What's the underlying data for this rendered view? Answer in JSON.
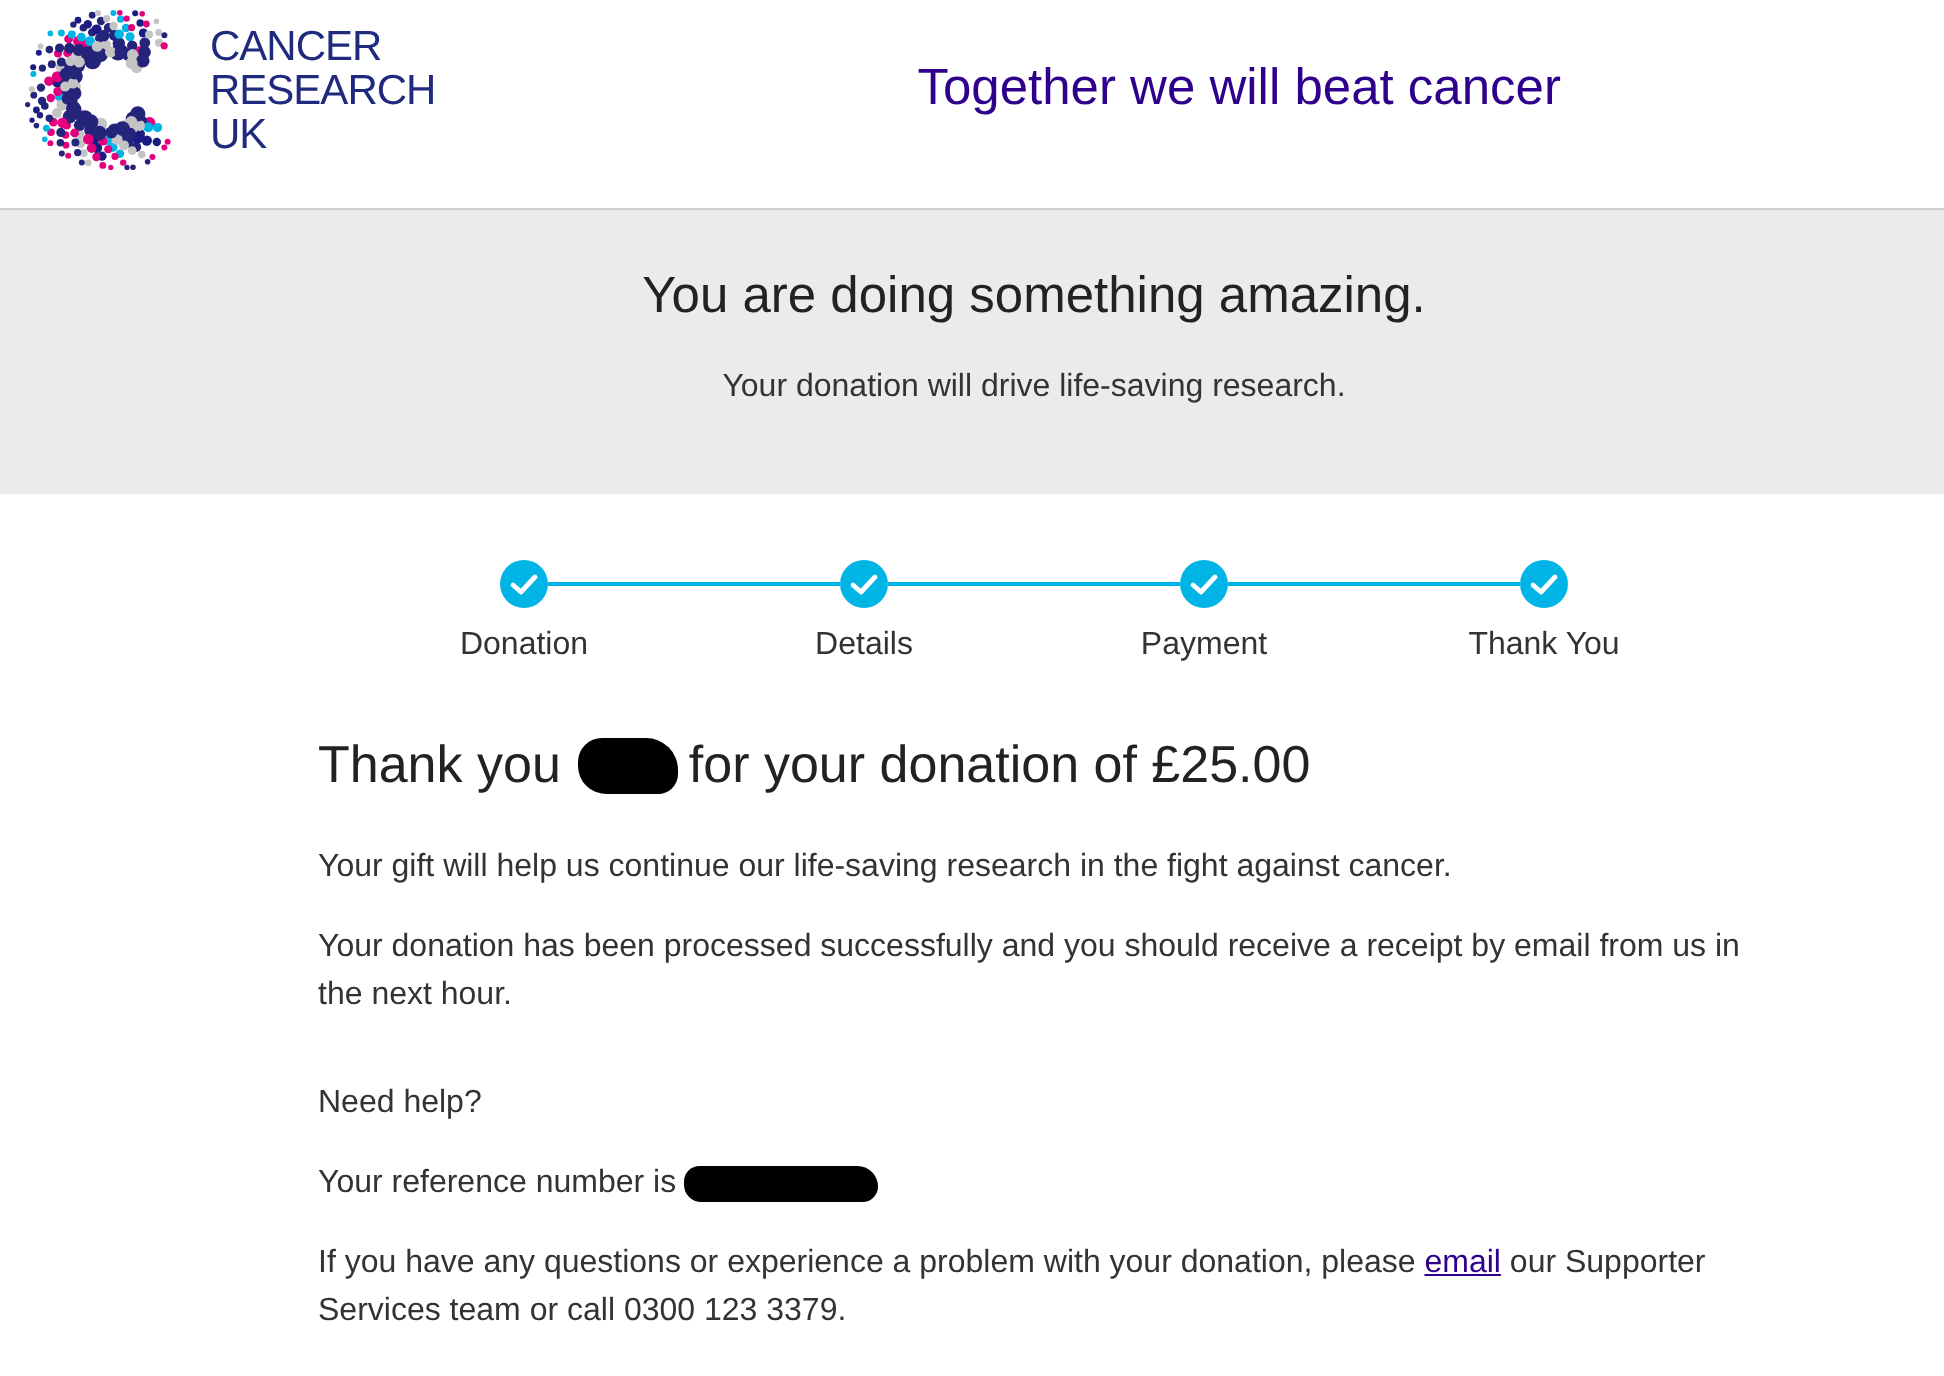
{
  "header": {
    "logo_lines": [
      "CANCER",
      "RESEARCH",
      "UK"
    ],
    "tagline": "Together we will beat cancer"
  },
  "banner": {
    "title": "You are doing something amazing.",
    "subtitle": "Your donation will drive life-saving research."
  },
  "steps": [
    {
      "label": "Donation",
      "completed": true
    },
    {
      "label": "Details",
      "completed": true
    },
    {
      "label": "Payment",
      "completed": true
    },
    {
      "label": "Thank You",
      "completed": true
    }
  ],
  "confirmation": {
    "heading_start": "Thank you",
    "name_redacted": true,
    "heading_end": "for your donation of £25.00",
    "paragraphs": [
      "Your gift will help us continue our life-saving research in the fight against cancer.",
      "Your donation has been processed successfully and you should receive a receipt by email from us in the next hour."
    ]
  },
  "help": {
    "title": "Need help?",
    "reference_label": "Your reference number is",
    "reference_redacted": true,
    "contact": {
      "before": "If you have any questions or experience a problem with your donation, please ",
      "link": "email",
      "after": " our Supporter Services team or call 0300 123 3379."
    }
  }
}
